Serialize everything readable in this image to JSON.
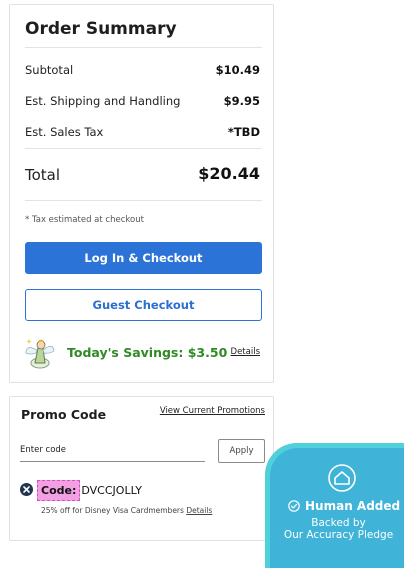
{
  "summary": {
    "title": "Order Summary",
    "rows": [
      {
        "label": "Subtotal",
        "value": "$10.49"
      },
      {
        "label": "Est. Shipping and Handling",
        "value": "$9.95"
      },
      {
        "label": "Est. Sales Tax",
        "value": "*TBD"
      }
    ],
    "total_label": "Total",
    "total_value": "$20.44",
    "tax_note": "* Tax estimated at checkout",
    "login_checkout_label": "Log In & Checkout",
    "guest_checkout_label": "Guest Checkout",
    "savings_text": "Today's Savings:  $3.50",
    "savings_details_label": "Details"
  },
  "promo": {
    "title": "Promo Code",
    "view_promotions_label": "View Current Promotions",
    "input_placeholder": "Enter code",
    "apply_label": "Apply",
    "applied_code_label": "Code:",
    "applied_code": "DVCCJOLLY",
    "applied_desc": "25% off for Disney Visa Cardmembers",
    "applied_details_label": "Details"
  },
  "pledge": {
    "title": "Human Added",
    "line1": "Backed by",
    "line2": "Our Accuracy Pledge"
  },
  "colors": {
    "primary": "#2b73d6",
    "savings_green": "#2f8a23",
    "pledge_teal": "#3fb4d8",
    "code_highlight": "#f3a0e3"
  },
  "icons": {
    "remove": "close-circle-icon",
    "savings_art": "tinker-bell-illustration",
    "pledge_logo": "house-badge-icon",
    "pledge_check": "check-circle-icon"
  }
}
